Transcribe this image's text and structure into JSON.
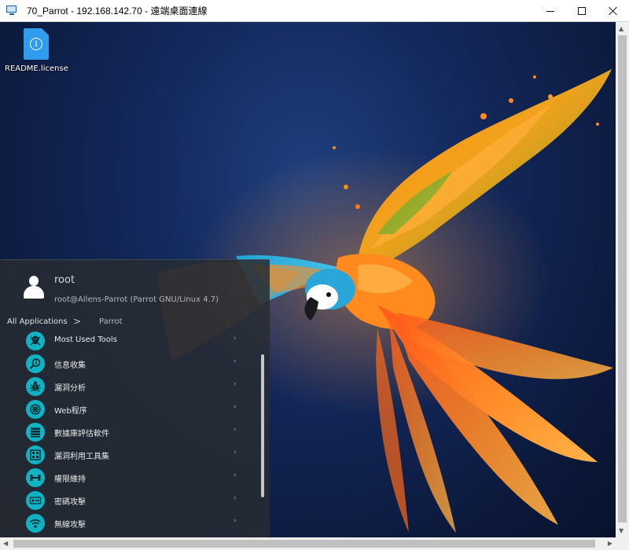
{
  "window": {
    "title": "70_Parrot - 192.168.142.70 - 遠端桌面連線"
  },
  "desktop": {
    "icons": [
      {
        "label": "README.license",
        "icon": "info-file-icon",
        "color": "#2f9cf0"
      }
    ]
  },
  "menu": {
    "user": {
      "name": "root",
      "host": "root@Allens-Parrot (Parrot GNU/Linux 4.7)"
    },
    "breadcrumb": {
      "all": "All Applications",
      "separator": ">",
      "current": "Parrot"
    },
    "items": [
      {
        "label": "Most Used Tools",
        "icon": "skull-icon"
      },
      {
        "label": "信息收集",
        "icon": "info-search-icon"
      },
      {
        "label": "漏洞分析",
        "icon": "bug-icon"
      },
      {
        "label": "Web程序",
        "icon": "web-icon"
      },
      {
        "label": "數據庫評估軟件",
        "icon": "database-icon"
      },
      {
        "label": "漏洞利用工具集",
        "icon": "exploit-icon"
      },
      {
        "label": "權限維持",
        "icon": "persistence-icon"
      },
      {
        "label": "密碼攻擊",
        "icon": "password-icon"
      },
      {
        "label": "無線攻擊",
        "icon": "wireless-icon"
      }
    ],
    "accent": "#12b2c5",
    "item_arrow": "›"
  }
}
